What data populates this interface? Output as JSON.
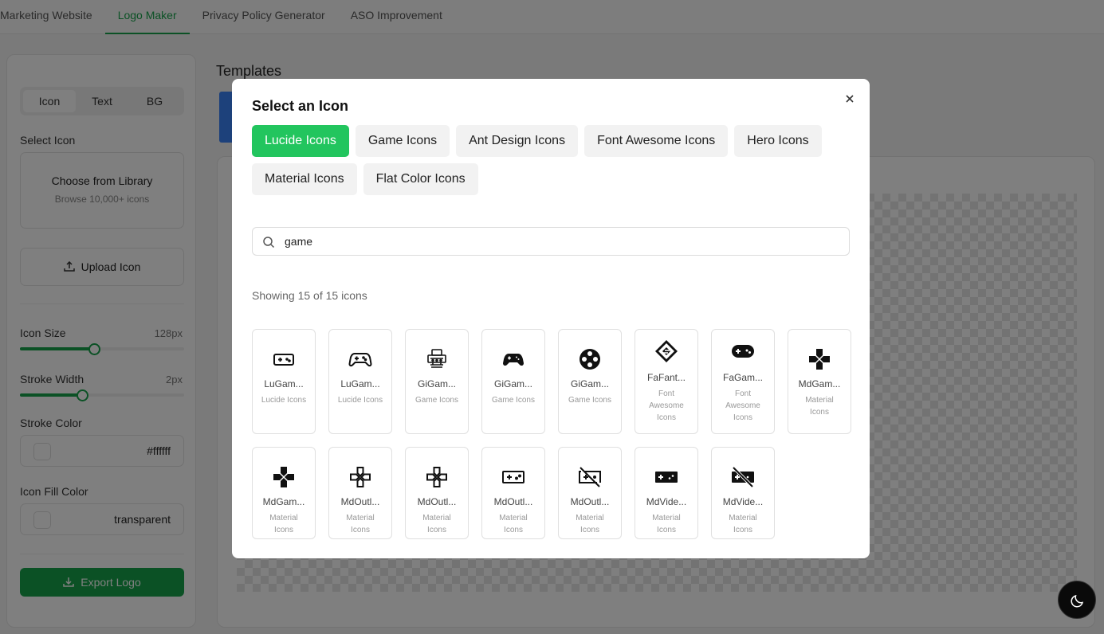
{
  "top_tabs": [
    "Marketing Website",
    "Logo Maker",
    "Privacy Policy Generator",
    "ASO Improvement"
  ],
  "panel": {
    "segments": [
      "Icon",
      "Text",
      "BG"
    ],
    "select_icon_label": "Select Icon",
    "library_title": "Choose from Library",
    "library_sub": "Browse 10,000+ icons",
    "upload_label": "Upload Icon",
    "icon_size_label": "Icon Size",
    "icon_size_value": "128px",
    "icon_size_fraction": 0.45,
    "stroke_width_label": "Stroke Width",
    "stroke_width_value": "2px",
    "stroke_width_fraction": 0.38,
    "stroke_color_label": "Stroke Color",
    "stroke_color_value": "#ffffff",
    "fill_color_label": "Icon Fill Color",
    "fill_color_value": "transparent",
    "export_label": "Export Logo"
  },
  "main": {
    "templates_title": "Templates"
  },
  "modal": {
    "title": "Select an Icon",
    "libraries": [
      "Lucide Icons",
      "Game Icons",
      "Ant Design Icons",
      "Font Awesome Icons",
      "Hero Icons",
      "Material Icons",
      "Flat Color Icons"
    ],
    "search_value": "game",
    "count_text": "Showing 15 of 15 icons",
    "icons": [
      {
        "name": "LuGam...",
        "lib": "Lucide Icons",
        "icon": "gamepad-outline-icon"
      },
      {
        "name": "LuGam...",
        "lib": "Lucide Icons",
        "icon": "gamepad-2-icon"
      },
      {
        "name": "GiGam...",
        "lib": "Game Icons",
        "icon": "game-console-icon"
      },
      {
        "name": "GiGam...",
        "lib": "Game Icons",
        "icon": "gamepad-solid-icon"
      },
      {
        "name": "GiGam...",
        "lib": "Game Icons",
        "icon": "gamepad-cross-icon"
      },
      {
        "name": "FaFant...",
        "lib": "Font Awesome Icons",
        "icon": "fantasy-flight-icon"
      },
      {
        "name": "FaGam...",
        "lib": "Font Awesome Icons",
        "icon": "gamepad-fa-icon"
      },
      {
        "name": "MdGam...",
        "lib": "Material Icons",
        "icon": "games-icon"
      },
      {
        "name": "MdGam...",
        "lib": "Material Icons",
        "icon": "games-icon"
      },
      {
        "name": "MdOutl...",
        "lib": "Material Icons",
        "icon": "games-outline-icon"
      },
      {
        "name": "MdOutl...",
        "lib": "Material Icons",
        "icon": "games-outline-icon"
      },
      {
        "name": "MdOutl...",
        "lib": "Material Icons",
        "icon": "videogame-outline-icon"
      },
      {
        "name": "MdOutl...",
        "lib": "Material Icons",
        "icon": "videogame-off-outline-icon"
      },
      {
        "name": "MdVide...",
        "lib": "Material Icons",
        "icon": "videogame-icon"
      },
      {
        "name": "MdVide...",
        "lib": "Material Icons",
        "icon": "videogame-off-icon"
      }
    ]
  },
  "colors": {
    "accent": "#16a34a",
    "active_tab": "#22c55e"
  }
}
